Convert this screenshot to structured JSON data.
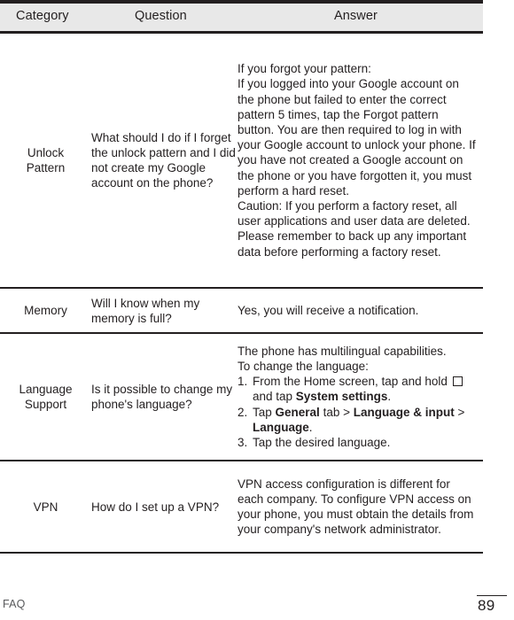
{
  "table": {
    "headers": {
      "category": "Category",
      "question": "Question",
      "answer": "Answer"
    },
    "rows": [
      {
        "category": "Unlock\nPattern",
        "category_lines": [
          "Unlock",
          "Pattern"
        ],
        "question": "What should I do if I forget the unlock pattern and I did not create my Google account on the phone?",
        "answer_paragraphs": [
          "If you forgot your pattern:",
          "If you logged into your Google account on the phone but failed to enter the correct pattern 5 times, tap the Forgot pattern button. You are then required to log in with your Google account to unlock your phone. If you have not created a Google account on the phone or you have forgotten it, you must perform a hard reset.",
          "Caution: If you perform a factory reset, all user applications and user data are deleted. Please remember to back up any important data before performing a factory reset."
        ]
      },
      {
        "category": "Memory",
        "question": "Will I know when my memory is full?",
        "answer_paragraphs": [
          "Yes, you will receive a notification."
        ]
      },
      {
        "category": "Language\nSupport",
        "category_lines": [
          "Language",
          "Support"
        ],
        "question": "Is it possible to change my phone's language?",
        "answer_intro": [
          "The phone has multilingual capabilities.",
          "To change the language:"
        ],
        "steps": [
          {
            "num": "1.",
            "parts": [
              {
                "text": "From the Home screen, tap and hold ",
                "bold": false
              },
              {
                "icon": "recent-apps-square-key"
              },
              {
                "text": " and tap ",
                "bold": false
              },
              {
                "text": "System settings",
                "bold": true
              },
              {
                "text": ".",
                "bold": false
              }
            ]
          },
          {
            "num": "2.",
            "parts": [
              {
                "text": "Tap ",
                "bold": false
              },
              {
                "text": "General",
                "bold": true
              },
              {
                "text": " tab > ",
                "bold": false
              },
              {
                "text": "Language & input",
                "bold": true
              },
              {
                "text": " > ",
                "bold": false
              },
              {
                "text": "Language",
                "bold": true
              },
              {
                "text": ".",
                "bold": false
              }
            ]
          },
          {
            "num": "3.",
            "parts": [
              {
                "text": "Tap the desired language.",
                "bold": false
              }
            ]
          }
        ]
      },
      {
        "category": "VPN",
        "question": "How do I set up a VPN?",
        "answer_paragraphs": [
          "VPN access configuration is different for each company. To configure VPN access on your phone, you must obtain the details from your company's network administrator."
        ]
      }
    ]
  },
  "footer": {
    "label": "FAQ",
    "page_number": "89"
  },
  "colors": {
    "text": "#231f20",
    "header_background": "#e8e8e8",
    "rule": "#231f20",
    "footer_label": "#58595b"
  }
}
